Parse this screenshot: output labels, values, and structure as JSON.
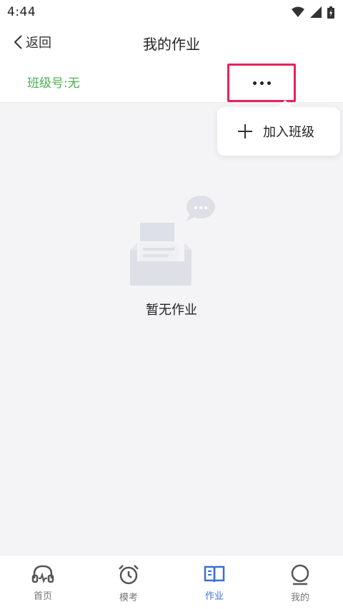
{
  "status_bar": {
    "time": "4:44"
  },
  "header": {
    "back_label": "返回",
    "title": "我的作业"
  },
  "subbar": {
    "class_number": "班级号:无"
  },
  "popup_menu": {
    "items": [
      {
        "label": "加入班级",
        "icon": "plus-icon"
      }
    ]
  },
  "empty_state": {
    "message": "暂无作业",
    "icon": "empty-inbox-icon"
  },
  "tabbar": {
    "items": [
      {
        "label": "首页",
        "icon": "headphones-icon",
        "active": false
      },
      {
        "label": "模考",
        "icon": "alarm-clock-icon",
        "active": false
      },
      {
        "label": "作业",
        "icon": "book-icon",
        "active": true
      },
      {
        "label": "我的",
        "icon": "profile-icon",
        "active": false
      }
    ]
  },
  "colors": {
    "accent_green": "#4caf50",
    "active_tab": "#3b6fd6",
    "highlight_border": "#e8225a",
    "background": "#f4f4f7"
  }
}
